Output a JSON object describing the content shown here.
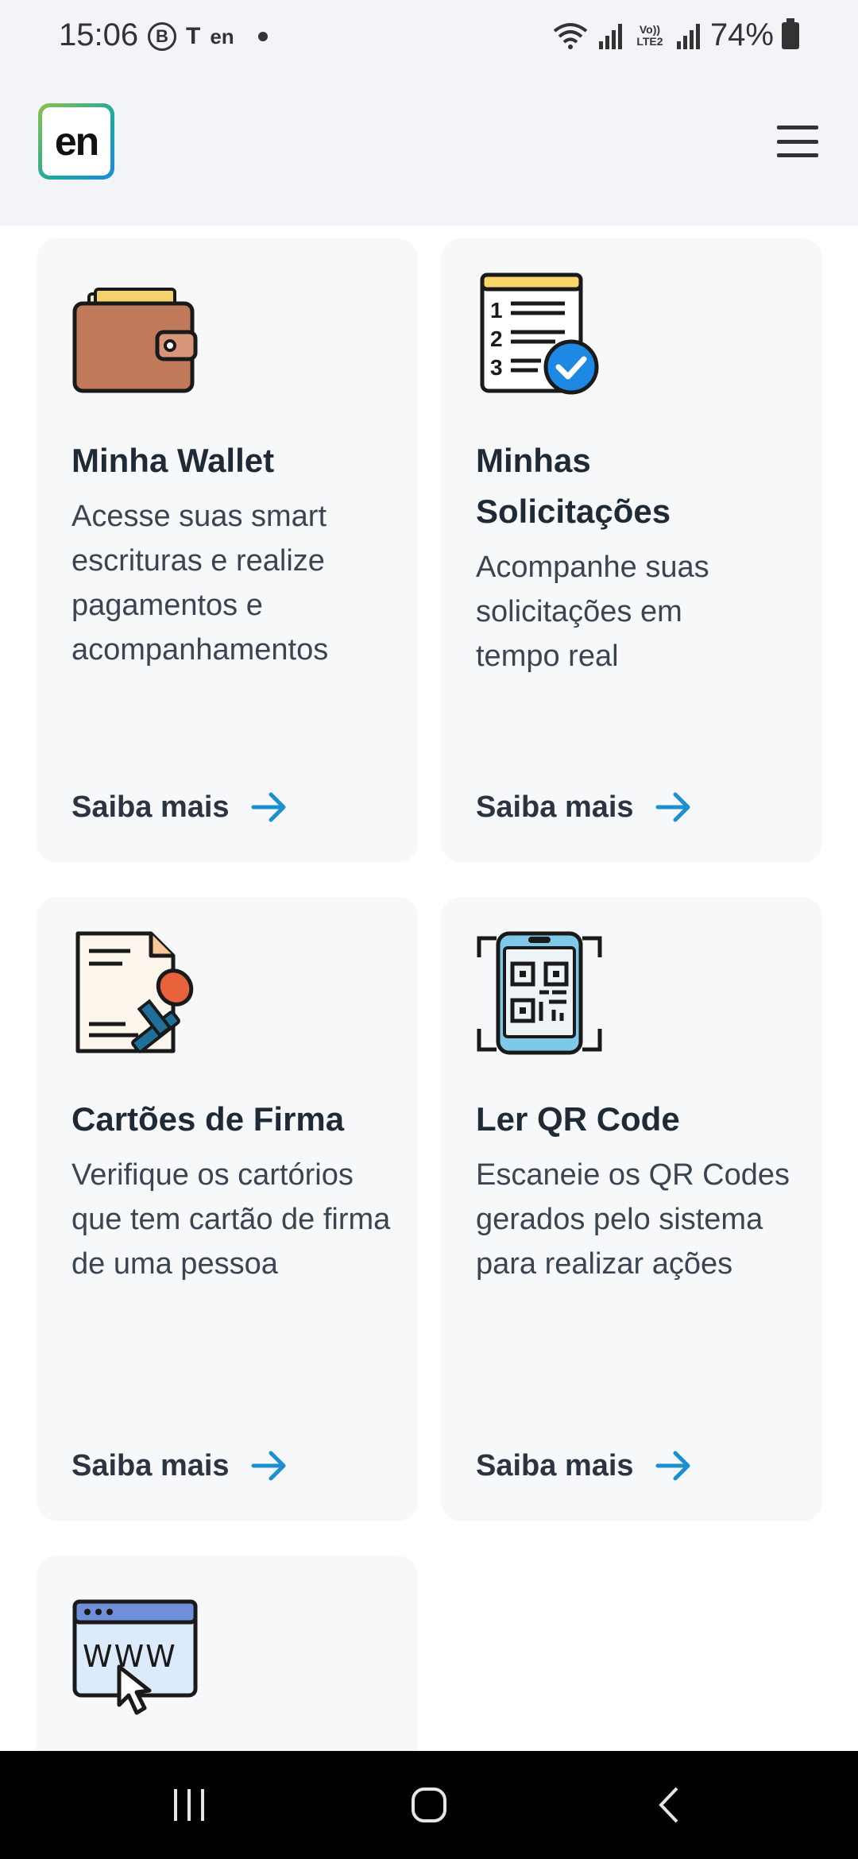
{
  "status_bar": {
    "time": "15:06",
    "left_icons": [
      "b-circle-icon",
      "teams-icon",
      "en-app-icon",
      "dot-icon"
    ],
    "b_label": "B",
    "teams_label": "T",
    "en_label": "en",
    "battery": "74%",
    "vo_label": "Vo)) LTE2"
  },
  "header": {
    "logo_text": "en",
    "menu_icon": "hamburger-menu-icon"
  },
  "cards": [
    {
      "icon": "wallet-icon",
      "title": "Minha Wallet",
      "description": "Acesse suas smart escrituras e realize pagamentos e acompanhamentos",
      "link": "Saiba mais"
    },
    {
      "icon": "checklist-icon",
      "title": "Minhas Solicitações",
      "description": "Acompanhe suas solicitações em tempo real",
      "link": "Saiba mais"
    },
    {
      "icon": "document-stamp-icon",
      "title": "Cartões de Firma",
      "description": "Verifique os cartórios que tem cartão de firma de uma pessoa",
      "link": "Saiba mais"
    },
    {
      "icon": "qr-phone-icon",
      "title": "Ler QR Code",
      "description": "Escaneie os QR Codes gerados pelo sistema para realizar ações",
      "link": "Saiba mais"
    },
    {
      "icon": "www-browser-icon",
      "title": "",
      "description": "",
      "link": ""
    }
  ],
  "colors": {
    "accent": "#1b8fd0",
    "card_bg": "#f7f8fa",
    "header_bg": "#f3f4f8",
    "title": "#1f2a37"
  },
  "nav": {
    "recent": "recent-apps-icon",
    "home": "home-icon",
    "back": "back-icon"
  }
}
